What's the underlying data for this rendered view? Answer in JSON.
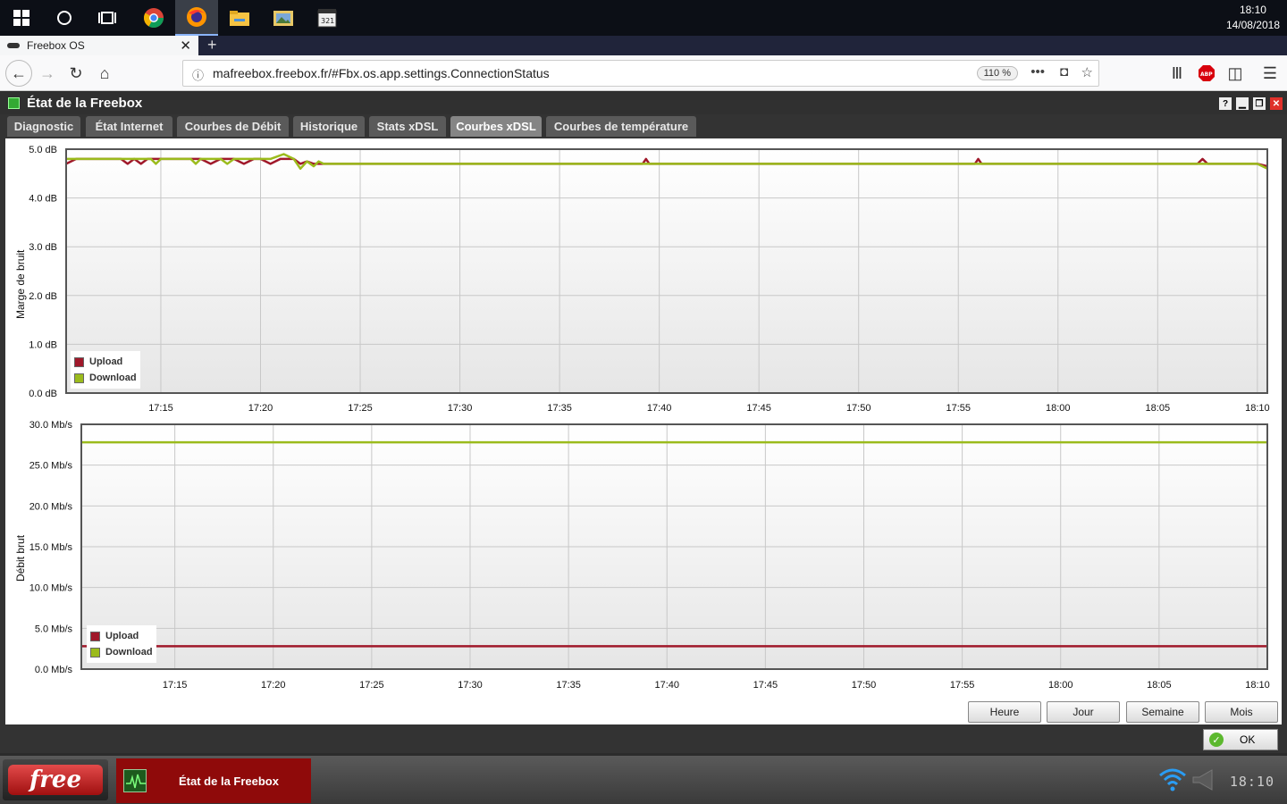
{
  "taskbar": {
    "clock_time": "18:10",
    "clock_date": "14/08/2018",
    "icons": [
      "windows-start-icon",
      "cortana-icon",
      "task-view-icon",
      "chrome-icon",
      "firefox-icon",
      "file-explorer-icon",
      "photos-icon",
      "media-player-icon"
    ]
  },
  "browser": {
    "tab_title": "Freebox OS",
    "url": "mafreebox.freebox.fr/#Fbx.os.app.settings.ConnectionStatus",
    "zoom": "110 %"
  },
  "app": {
    "title": "État de la Freebox",
    "tabs": [
      "Diagnostic",
      "État Internet",
      "Courbes de Débit",
      "Historique",
      "Stats xDSL",
      "Courbes xDSL",
      "Courbes de température"
    ],
    "selected_tab": "Courbes xDSL",
    "period_buttons": [
      "Heure",
      "Jour",
      "Semaine",
      "Mois"
    ],
    "ok_label": "OK"
  },
  "osbar": {
    "app_label": "État de la Freebox",
    "clock": "18:10",
    "logo_text": "free"
  },
  "colors": {
    "upload": "#a0182a",
    "download": "#9bbb1c"
  },
  "chart_data": [
    {
      "type": "line",
      "ylabel": "Marge de bruit",
      "yticks": [
        "0.0 dB",
        "1.0 dB",
        "2.0 dB",
        "3.0 dB",
        "4.0 dB",
        "5.0 dB"
      ],
      "ylim": [
        0,
        5
      ],
      "xticks": [
        "17:15",
        "17:20",
        "17:25",
        "17:30",
        "17:35",
        "17:40",
        "17:45",
        "17:50",
        "17:55",
        "18:00",
        "18:05",
        "18:10"
      ],
      "xlim": [
        "17:10:15",
        "18:10:30"
      ],
      "legend": "bottom-left",
      "grid": true,
      "series": [
        {
          "name": "Upload",
          "points": [
            [
              "17:10:15",
              4.7
            ],
            [
              "17:10:45",
              4.8
            ],
            [
              "17:13:00",
              4.8
            ],
            [
              "17:13:20",
              4.7
            ],
            [
              "17:13:40",
              4.8
            ],
            [
              "17:14:00",
              4.7
            ],
            [
              "17:14:20",
              4.8
            ],
            [
              "17:17:00",
              4.8
            ],
            [
              "17:17:30",
              4.7
            ],
            [
              "17:18:00",
              4.8
            ],
            [
              "17:18:40",
              4.8
            ],
            [
              "17:19:10",
              4.7
            ],
            [
              "17:19:40",
              4.8
            ],
            [
              "17:20:00",
              4.8
            ],
            [
              "17:20:30",
              4.7
            ],
            [
              "17:21:00",
              4.8
            ],
            [
              "17:21:40",
              4.8
            ],
            [
              "17:22:00",
              4.7
            ],
            [
              "17:22:20",
              4.75
            ],
            [
              "17:22:40",
              4.7
            ],
            [
              "17:39:10",
              4.7
            ],
            [
              "17:39:20",
              4.8
            ],
            [
              "17:39:30",
              4.7
            ],
            [
              "17:55:50",
              4.7
            ],
            [
              "17:56:00",
              4.8
            ],
            [
              "17:56:10",
              4.7
            ],
            [
              "18:07:00",
              4.7
            ],
            [
              "18:07:15",
              4.8
            ],
            [
              "18:07:30",
              4.7
            ],
            [
              "18:10:00",
              4.7
            ],
            [
              "18:10:30",
              4.65
            ]
          ]
        },
        {
          "name": "Download",
          "points": [
            [
              "17:10:15",
              4.8
            ],
            [
              "17:14:30",
              4.8
            ],
            [
              "17:14:45",
              4.7
            ],
            [
              "17:15:00",
              4.8
            ],
            [
              "17:16:30",
              4.8
            ],
            [
              "17:16:45",
              4.7
            ],
            [
              "17:17:00",
              4.8
            ],
            [
              "17:18:00",
              4.8
            ],
            [
              "17:18:20",
              4.7
            ],
            [
              "17:18:40",
              4.8
            ],
            [
              "17:20:30",
              4.8
            ],
            [
              "17:21:10",
              4.9
            ],
            [
              "17:21:40",
              4.8
            ],
            [
              "17:22:00",
              4.6
            ],
            [
              "17:22:20",
              4.75
            ],
            [
              "17:22:40",
              4.65
            ],
            [
              "17:22:55",
              4.75
            ],
            [
              "17:23:10",
              4.7
            ],
            [
              "18:10:00",
              4.7
            ],
            [
              "18:10:30",
              4.6
            ]
          ]
        }
      ]
    },
    {
      "type": "line",
      "ylabel": "Débit brut",
      "yticks": [
        "0.0 Mb/s",
        "5.0 Mb/s",
        "10.0 Mb/s",
        "15.0 Mb/s",
        "20.0 Mb/s",
        "25.0 Mb/s",
        "30.0 Mb/s"
      ],
      "ylim": [
        0,
        30
      ],
      "xticks": [
        "17:15",
        "17:20",
        "17:25",
        "17:30",
        "17:35",
        "17:40",
        "17:45",
        "17:50",
        "17:55",
        "18:00",
        "18:05",
        "18:10"
      ],
      "xlim": [
        "17:10:15",
        "18:10:30"
      ],
      "legend": "bottom-left",
      "grid": true,
      "series": [
        {
          "name": "Upload",
          "points": [
            [
              "17:10:15",
              2.8
            ],
            [
              "18:10:30",
              2.8
            ]
          ]
        },
        {
          "name": "Download",
          "points": [
            [
              "17:10:15",
              27.8
            ],
            [
              "18:10:30",
              27.8
            ]
          ]
        }
      ]
    }
  ]
}
